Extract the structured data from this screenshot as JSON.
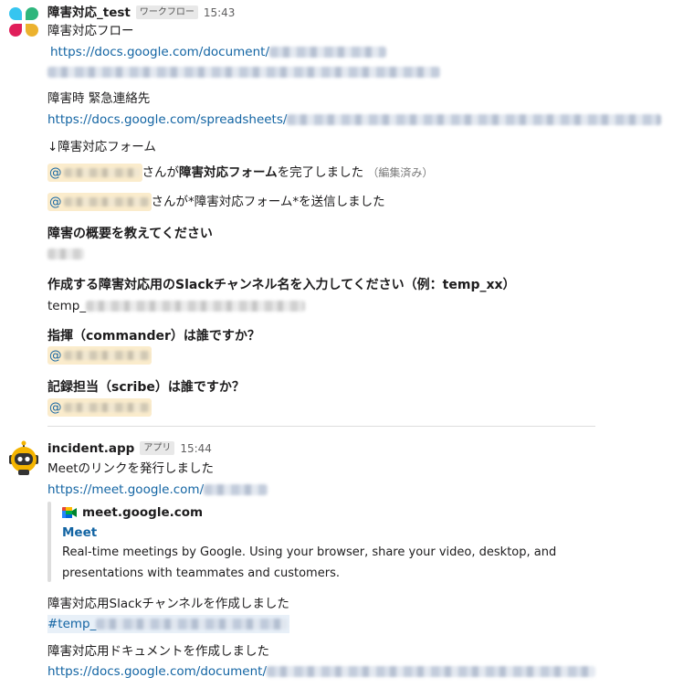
{
  "message1": {
    "sender": "障害対応_test",
    "badge": "ワークフロー",
    "time": "15:43",
    "title": "障害対応フロー",
    "doc_link": "https://docs.google.com/document/",
    "emergency_label": "障害時 緊急連絡先",
    "sheet_link": "https://docs.google.com/spreadsheets/",
    "form_arrow": "↓障害対応フォーム",
    "mention_prefix": "@",
    "completed_text_1": "さんが",
    "completed_form": "障害対応フォーム",
    "completed_text_2": "を完了しました",
    "edited": "（編集済み）",
    "sent_text": "さんが*障害対応フォーム*を送信しました",
    "q1": "障害の概要を教えてください",
    "q2": "作成する障害対応用のSlackチャンネル名を入力してください（例：temp_xx）",
    "a2_prefix": "temp_",
    "q3": "指揮（commander）は誰ですか？",
    "q4": "記録担当（scribe）は誰ですか？"
  },
  "message2": {
    "sender": "incident.app",
    "badge": "アプリ",
    "time": "15:44",
    "meet_text": "Meetのリンクを発行しました",
    "meet_link": "https://meet.google.com/",
    "unfurl": {
      "site": "meet.google.com",
      "title": "Meet",
      "desc_line1": "Real-time meetings by Google. Using your browser, share your video, desktop, and",
      "desc_line2": "presentations with teammates and customers."
    },
    "channel_text": "障害対応用Slackチャンネルを作成しました",
    "channel_link": "#temp_",
    "doc_text": "障害対応用ドキュメントを作成しました",
    "doc_link": "https://docs.google.com/document/"
  },
  "colors": {
    "link": "#1264a3",
    "mention_bg": "#fbeccc",
    "text": "#1d1c1d"
  }
}
